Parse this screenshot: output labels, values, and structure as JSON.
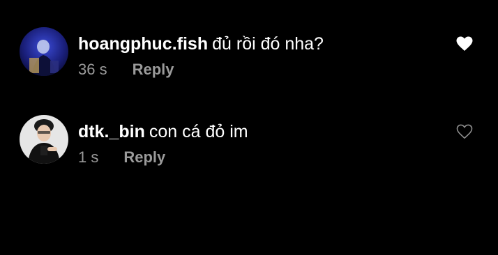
{
  "comments": [
    {
      "username": "hoangphuc.fish",
      "text": "đủ rồi đó nha?",
      "time": "36 s",
      "reply_label": "Reply",
      "liked": true,
      "avatar_icon": "avatar-photo"
    },
    {
      "username": "dtk._bin",
      "text": "con cá đỏ im",
      "time": "1 s",
      "reply_label": "Reply",
      "liked": false,
      "avatar_icon": "avatar-photo"
    }
  ],
  "colors": {
    "background": "#000000",
    "primary_text": "#ffffff",
    "secondary_text": "#9a9a9a",
    "like_outline": "#8e8e8e"
  }
}
